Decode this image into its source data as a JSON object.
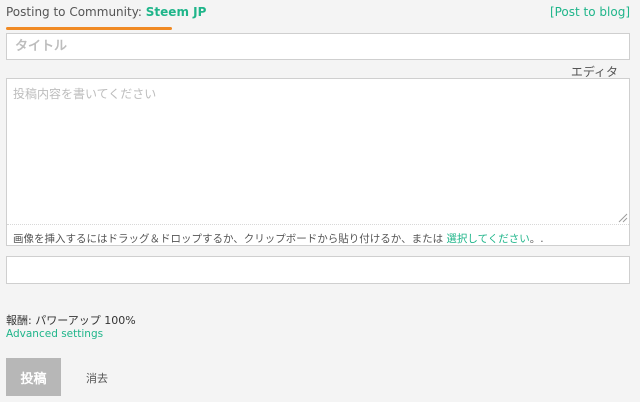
{
  "community": {
    "label": "Posting to Community: ",
    "name": "Steem JP",
    "post_to_blog": "[Post to blog]"
  },
  "title": {
    "placeholder": "タイトル",
    "value": ""
  },
  "editor": {
    "toggle_label": "エディタ",
    "placeholder": "投稿内容を書いてください",
    "value": ""
  },
  "upload": {
    "hint_before": "画像を挿入するにはドラッグ＆ドロップするか、クリップボードから貼り付けるか、または ",
    "select_link": "選択してください",
    "hint_after": "。."
  },
  "tags": {
    "value": ""
  },
  "rewards": {
    "label": "報酬: ",
    "value": "パワーアップ 100%"
  },
  "advanced": {
    "label": "Advanced settings"
  },
  "actions": {
    "post_label": "投稿",
    "clear_label": "消去"
  },
  "colors": {
    "accent": "#1fb58a",
    "underline": "#f08a24",
    "disabled_button": "#b7b7b7"
  }
}
